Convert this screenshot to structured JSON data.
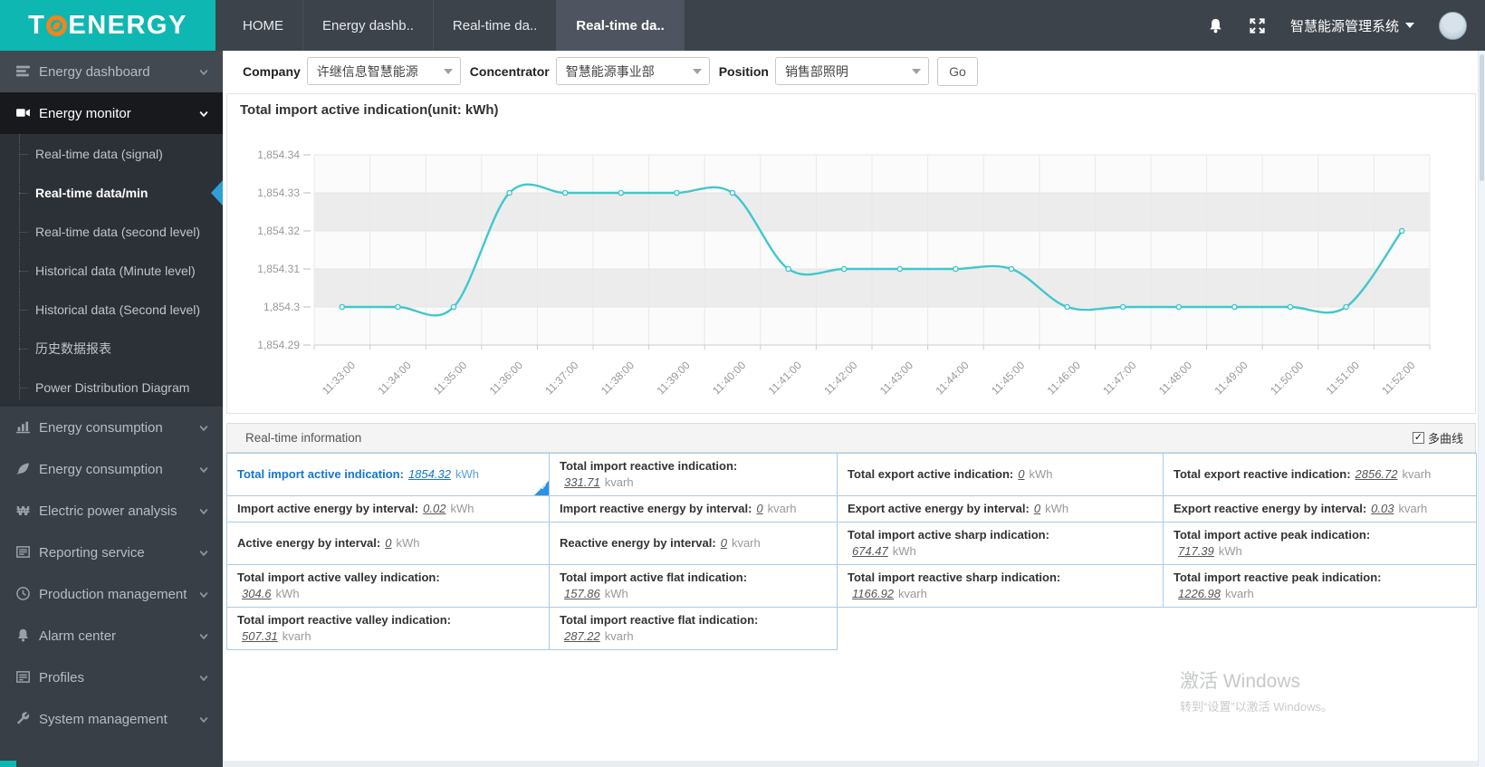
{
  "colors": {
    "brand_teal": "#0fb7b2",
    "logo_orange": "#f0851e",
    "accent_blue": "#1476d2",
    "active_arrow": "#2f9fda",
    "chart_line": "#41c7cd"
  },
  "header": {
    "logo": {
      "prefix": "T",
      "suffix": "ENERGY"
    },
    "tabs": [
      {
        "label": "HOME",
        "active": false
      },
      {
        "label": "Energy dashb..",
        "active": false
      },
      {
        "label": "Real-time da..",
        "active": false
      },
      {
        "label": "Real-time da..",
        "active": true
      }
    ],
    "system_menu": {
      "label": "智慧能源管理系统"
    }
  },
  "sidebar": {
    "items": [
      {
        "label": "Energy dashboard",
        "icon": "dashboard-icon",
        "active": false
      },
      {
        "label": "Energy monitor",
        "icon": "monitor-camera-icon",
        "active": true,
        "children": [
          {
            "label": "Real-time data (signal)",
            "active": false
          },
          {
            "label": "Real-time data/min",
            "active": true
          },
          {
            "label": "Real-time data (second level)",
            "active": false
          },
          {
            "label": "Historical data (Minute level)",
            "active": false
          },
          {
            "label": "Historical data (Second level)",
            "active": false
          },
          {
            "label": "历史数据报表",
            "active": false
          },
          {
            "label": "Power Distribution Diagram",
            "active": false
          }
        ]
      },
      {
        "label": "Energy consumption",
        "icon": "bar-chart-icon",
        "active": false
      },
      {
        "label": "Energy consumption",
        "icon": "leaf-icon",
        "active": false
      },
      {
        "label": "Electric power analysis",
        "icon": "won-icon",
        "active": false
      },
      {
        "label": "Reporting service",
        "icon": "report-icon",
        "active": false
      },
      {
        "label": "Production management",
        "icon": "clock-icon",
        "active": false
      },
      {
        "label": "Alarm center",
        "icon": "alarm-bell-icon",
        "active": false
      },
      {
        "label": "Profiles",
        "icon": "profiles-icon",
        "active": false
      },
      {
        "label": "System management",
        "icon": "wrench-icon",
        "active": false
      }
    ]
  },
  "filters": {
    "company": {
      "label": "Company",
      "value": "许继信息智慧能源"
    },
    "concentrator": {
      "label": "Concentrator",
      "value": "智慧能源事业部"
    },
    "position": {
      "label": "Position",
      "value": "销售部照明"
    },
    "go_label": "Go"
  },
  "chart": {
    "chart_data": {
      "type": "line",
      "title": "Total import active indication(unit:  kWh)",
      "x": [
        "11:33:00",
        "11:34:00",
        "11:35:00",
        "11:36:00",
        "11:37:00",
        "11:38:00",
        "11:39:00",
        "11:40:00",
        "11:41:00",
        "11:42:00",
        "11:43:00",
        "11:44:00",
        "11:45:00",
        "11:46:00",
        "11:47:00",
        "11:48:00",
        "11:49:00",
        "11:50:00",
        "11:51:00",
        "11:52:00"
      ],
      "values": [
        1854.3,
        1854.3,
        1854.3,
        1854.33,
        1854.33,
        1854.33,
        1854.33,
        1854.33,
        1854.31,
        1854.31,
        1854.31,
        1854.31,
        1854.31,
        1854.3,
        1854.3,
        1854.3,
        1854.3,
        1854.3,
        1854.3,
        1854.32
      ],
      "ylim": [
        1854.29,
        1854.34
      ],
      "y_ticks": [
        "1,854.34",
        "1,854.33",
        "1,854.32",
        "1,854.31",
        "1,854.3",
        "1,854.29"
      ],
      "xlabel": "",
      "ylabel": "",
      "grid": true,
      "legend": false,
      "line_color": "#41c7cd"
    }
  },
  "realtime": {
    "title": "Real-time information",
    "multi_curve": {
      "label": "多曲线",
      "checked": true
    },
    "rows": [
      [
        {
          "label": "Total import active indication:",
          "value": "1854.32",
          "unit": "kWh",
          "selected": true
        },
        {
          "label": "Total import reactive indication:",
          "value": "331.71",
          "unit": "kvarh",
          "wrap": true
        },
        {
          "label": "Total export active indication:",
          "value": "0",
          "unit": "kWh"
        },
        {
          "label": "Total export reactive indication:",
          "value": "2856.72",
          "unit": "kvarh"
        }
      ],
      [
        {
          "label": "Import active energy by interval:",
          "value": "0.02",
          "unit": "kWh"
        },
        {
          "label": "Import reactive energy by interval:",
          "value": "0",
          "unit": "kvarh"
        },
        {
          "label": "Export active energy by interval:",
          "value": "0",
          "unit": "kWh"
        },
        {
          "label": "Export reactive energy by interval:",
          "value": "0.03",
          "unit": "kvarh"
        }
      ],
      [
        {
          "label": "Active energy by interval:",
          "value": "0",
          "unit": "kWh"
        },
        {
          "label": "Reactive energy by interval:",
          "value": "0",
          "unit": "kvarh"
        },
        {
          "label": "Total import active sharp indication:",
          "value": "674.47",
          "unit": "kWh",
          "wrap": true
        },
        {
          "label": "Total import active peak indication:",
          "value": "717.39",
          "unit": "kWh",
          "wrap": true
        }
      ],
      [
        {
          "label": "Total import active valley indication:",
          "value": "304.6",
          "unit": "kWh",
          "wrap": true
        },
        {
          "label": "Total import active flat indication:",
          "value": "157.86",
          "unit": "kWh",
          "wrap": true
        },
        {
          "label": "Total import reactive sharp indication:",
          "value": "1166.92",
          "unit": "kvarh",
          "wrap": true
        },
        {
          "label": "Total import reactive peak indication:",
          "value": "1226.98",
          "unit": "kvarh",
          "wrap": true
        }
      ],
      [
        {
          "label": "Total import reactive valley indication:",
          "value": "507.31",
          "unit": "kvarh",
          "wrap": true
        },
        {
          "label": "Total import reactive flat indication:",
          "value": "287.22",
          "unit": "kvarh",
          "wrap": true
        },
        {
          "empty": true
        },
        {
          "empty": true
        }
      ]
    ]
  },
  "watermark": {
    "line1": "激活 Windows",
    "line2": "转到“设置”以激活 Windows。"
  }
}
